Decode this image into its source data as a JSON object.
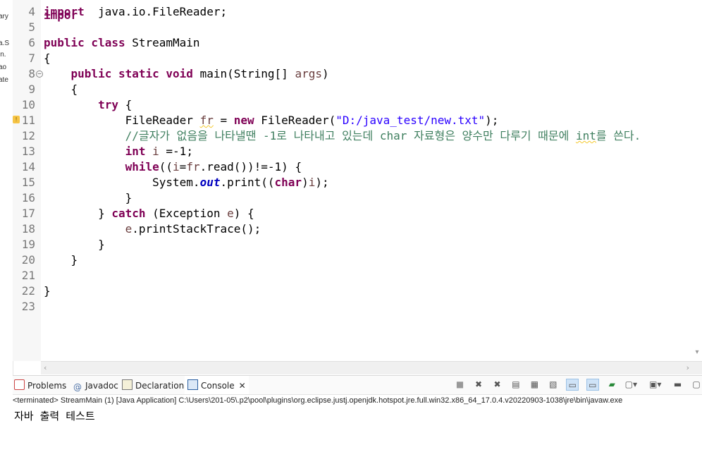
{
  "left_strip": [
    "ary",
    "a.S",
    "in.",
    "ao",
    "ate"
  ],
  "editor": {
    "lines": [
      {
        "num": "4",
        "segments": [
          [
            "kw",
            "import"
          ],
          [
            "",
            "  java.io.FileReader;"
          ]
        ]
      },
      {
        "num": "5",
        "segments": []
      },
      {
        "num": "6",
        "segments": [
          [
            "kw",
            "public"
          ],
          [
            "",
            ""
          ],
          [
            "kw",
            " class"
          ],
          [
            "",
            " StreamMain"
          ]
        ]
      },
      {
        "num": "7",
        "segments": [
          [
            "",
            "{"
          ]
        ]
      },
      {
        "num": "8",
        "segments": [
          [
            "",
            "    "
          ],
          [
            "kw",
            "public"
          ],
          [
            "kw",
            " static"
          ],
          [
            "kw",
            " void"
          ],
          [
            "",
            " main(String[] "
          ],
          [
            "var",
            "args"
          ],
          [
            "",
            ")"
          ]
        ]
      },
      {
        "num": "9",
        "segments": [
          [
            "",
            "    {"
          ]
        ]
      },
      {
        "num": "10",
        "segments": [
          [
            "",
            "        "
          ],
          [
            "kw",
            "try"
          ],
          [
            "",
            " {"
          ]
        ]
      },
      {
        "num": "11",
        "segments": [
          [
            "",
            "            FileReader "
          ],
          [
            "varw",
            "fr"
          ],
          [
            "",
            " = "
          ],
          [
            "kw",
            "new"
          ],
          [
            "",
            " FileReader("
          ],
          [
            "str",
            "\"D:/java_test/new.txt\""
          ],
          [
            "",
            ");"
          ]
        ]
      },
      {
        "num": "12",
        "segments": [
          [
            "",
            "            "
          ],
          [
            "cmt",
            "//글자가 없음을 나타낼땐 -1로 나타내고 있는데 char 자료형은 양수만 다루기 때문에 "
          ],
          [
            "cmtw",
            "int"
          ],
          [
            "cmt",
            "를 쓴다."
          ]
        ]
      },
      {
        "num": "13",
        "segments": [
          [
            "",
            "            "
          ],
          [
            "kw",
            "int"
          ],
          [
            "",
            " "
          ],
          [
            "var",
            "i"
          ],
          [
            "",
            " =-1;"
          ]
        ]
      },
      {
        "num": "14",
        "segments": [
          [
            "",
            "            "
          ],
          [
            "kw",
            "while"
          ],
          [
            "",
            "(("
          ],
          [
            "var",
            "i"
          ],
          [
            "",
            "="
          ],
          [
            "var",
            "fr"
          ],
          [
            "",
            ".read())!=-1) {"
          ]
        ]
      },
      {
        "num": "15",
        "segments": [
          [
            "",
            "                System."
          ],
          [
            "fld",
            "out"
          ],
          [
            "",
            ".print(("
          ],
          [
            "kw",
            "char"
          ],
          [
            "",
            ")"
          ],
          [
            "var",
            "i"
          ],
          [
            "",
            ");"
          ]
        ]
      },
      {
        "num": "16",
        "segments": [
          [
            "",
            "            }"
          ]
        ]
      },
      {
        "num": "17",
        "segments": [
          [
            "",
            "        } "
          ],
          [
            "kw",
            "catch"
          ],
          [
            "",
            " (Exception "
          ],
          [
            "var",
            "e"
          ],
          [
            "",
            ") {"
          ]
        ]
      },
      {
        "num": "18",
        "segments": [
          [
            "",
            "            "
          ],
          [
            "var",
            "e"
          ],
          [
            "",
            ".printStackTrace();"
          ]
        ]
      },
      {
        "num": "19",
        "segments": [
          [
            "",
            "        }"
          ]
        ]
      },
      {
        "num": "20",
        "segments": [
          [
            "",
            "    }"
          ]
        ]
      },
      {
        "num": "21",
        "segments": []
      },
      {
        "num": "22",
        "segments": [
          [
            "",
            "}"
          ]
        ]
      },
      {
        "num": "23",
        "segments": []
      }
    ]
  },
  "panel": {
    "tabs": [
      {
        "label": "Problems",
        "icon": "problems-icon"
      },
      {
        "label": "Javadoc",
        "icon": "javadoc-icon"
      },
      {
        "label": "Declaration",
        "icon": "declaration-icon"
      },
      {
        "label": "Console",
        "icon": "console-icon",
        "active": true
      }
    ],
    "terminated_line": "<terminated> StreamMain (1) [Java Application] C:\\Users\\201-05\\.p2\\pool\\plugins\\org.eclipse.justj.openjdk.hotspot.jre.full.win32.x86_64_17.0.4.v20220903-1038\\jre\\bin\\javaw.exe",
    "console_output": "자바 출력 테스트"
  },
  "colors": {
    "keyword": "#7f0055",
    "string": "#2a00ff",
    "comment": "#3f7f5f",
    "field": "#0000c0"
  }
}
